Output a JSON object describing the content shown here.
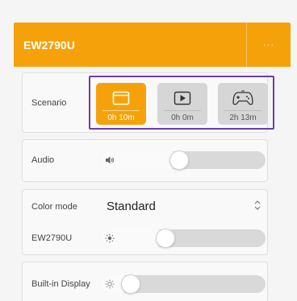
{
  "header": {
    "title": "EW2790U",
    "more": "···",
    "accent": "#f5a20a"
  },
  "scenario": {
    "label": "Scenario",
    "highlight_color": "#6c3fa6",
    "buttons": [
      {
        "icon": "window-icon",
        "time": "0h 10m",
        "active": true
      },
      {
        "icon": "play-icon",
        "time": "0h 0m",
        "active": false
      },
      {
        "icon": "gamepad-icon",
        "time": "2h 13m",
        "active": false
      }
    ]
  },
  "audio": {
    "label": "Audio",
    "icon": "speaker-icon",
    "level": 0.48
  },
  "color_mode": {
    "label": "Color mode",
    "value": "Standard",
    "chevron_icon": "chevron-updown-icon"
  },
  "brightness_ew": {
    "label": "EW2790U",
    "icon": "sun-icon",
    "level": 0.4
  },
  "brightness_builtin": {
    "label": "Built-in Display",
    "icon": "sun-icon",
    "level": 0.19
  }
}
